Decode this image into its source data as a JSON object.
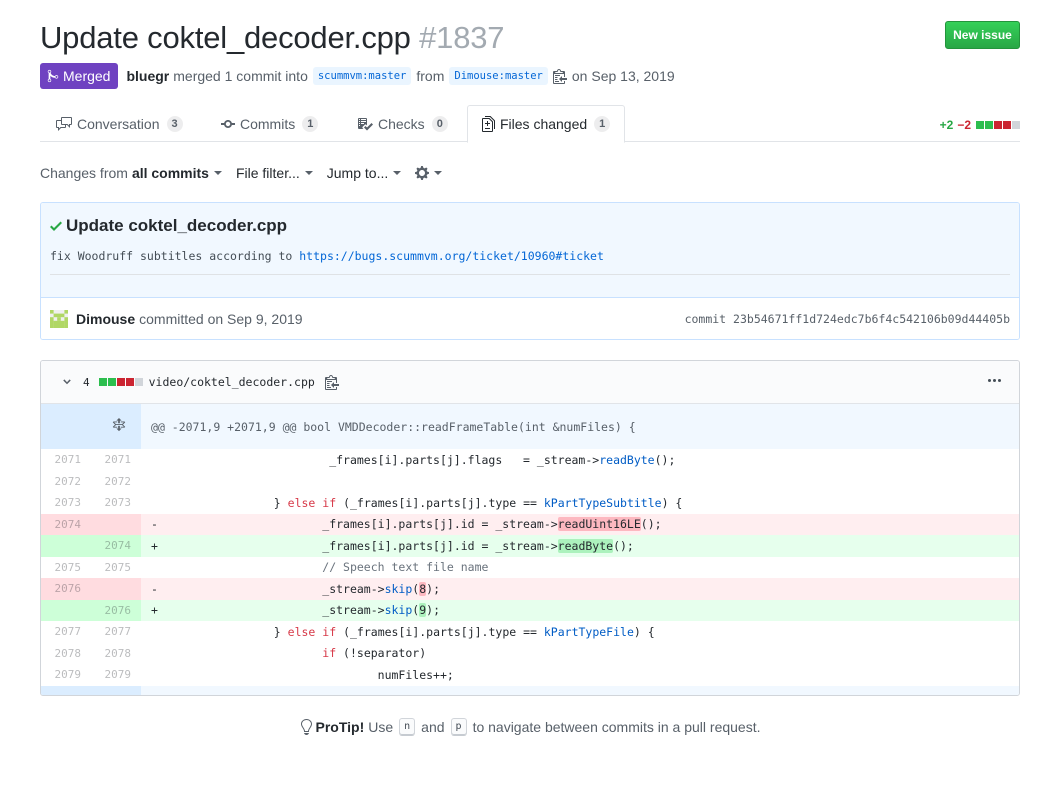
{
  "header": {
    "title": "Update coktel_decoder.cpp",
    "number": "#1837",
    "new_issue_label": "New issue"
  },
  "meta": {
    "state_label": "Merged",
    "author": "bluegr",
    "action_text": "merged 1 commit into",
    "base_branch": "scummvm:master",
    "from_text": "from",
    "head_branch": "Dimouse:master",
    "date_text": "on Sep 13, 2019"
  },
  "tabs": [
    {
      "label": "Conversation",
      "count": "3",
      "icon": "comment-discussion-icon"
    },
    {
      "label": "Commits",
      "count": "1",
      "icon": "git-commit-icon"
    },
    {
      "label": "Checks",
      "count": "0",
      "icon": "checklist-icon"
    },
    {
      "label": "Files changed",
      "count": "1",
      "icon": "file-diff-icon",
      "selected": true
    }
  ],
  "diffstat": {
    "additions": "+2",
    "deletions": "−2"
  },
  "toolbar": {
    "changes_prefix": "Changes from",
    "changes_value": "all commits",
    "file_filter": "File filter...",
    "jump_to": "Jump to..."
  },
  "commit": {
    "title": "Update coktel_decoder.cpp",
    "desc_text": "fix Woodruff subtitles according to ",
    "desc_link": "https://bugs.scummvm.org/ticket/10960#ticket",
    "author": "Dimouse",
    "committed_text": "committed on Sep 9, 2019",
    "sha_label": "commit",
    "sha": "23b54671ff1d724edc7b6f4c542106b09d44405b"
  },
  "file": {
    "change_count": "4",
    "path": "video/coktel_decoder.cpp",
    "hunk_header": "@@ -2071,9 +2071,9 @@ bool VMDDecoder::readFrameTable(int &numFiles) {"
  },
  "diff_lines": [
    {
      "type": "ctx",
      "old": "2071",
      "new": "2071"
    },
    {
      "type": "ctx",
      "old": "2072",
      "new": "2072"
    },
    {
      "type": "ctx",
      "old": "2073",
      "new": "2073"
    },
    {
      "type": "del",
      "old": "2074",
      "new": ""
    },
    {
      "type": "add",
      "old": "",
      "new": "2074"
    },
    {
      "type": "ctx",
      "old": "2075",
      "new": "2075"
    },
    {
      "type": "del",
      "old": "2076",
      "new": ""
    },
    {
      "type": "add",
      "old": "",
      "new": "2076"
    },
    {
      "type": "ctx",
      "old": "2077",
      "new": "2077"
    },
    {
      "type": "ctx",
      "old": "2078",
      "new": "2078"
    },
    {
      "type": "ctx",
      "old": "2079",
      "new": "2079"
    }
  ],
  "code": {
    "l1_a": "_frames[i].parts[j].flags   = _stream->",
    "l1_fn": "readByte",
    "l1_b": "();",
    "l3_a": "} ",
    "l3_kw1": "else",
    "l3_sp": " ",
    "l3_kw2": "if",
    "l3_b": " (_frames[i].parts[j].type == ",
    "l3_fn": "kPartTypeSubtitle",
    "l3_c": ") {",
    "l4_mark": "-",
    "l4_a": "_frames[i].parts[j].id = _stream->",
    "l4_hl": "readUint16LE",
    "l4_b": "();",
    "l5_mark": "+",
    "l5_a": "_frames[i].parts[j].id = _stream->",
    "l5_hl": "readByte",
    "l5_b": "();",
    "l6_cm": "// Speech text file name",
    "l7_mark": "-",
    "l7_a": "_stream->",
    "l7_fn": "skip",
    "l7_p1": "(",
    "l7_hl": "8",
    "l7_p2": ");",
    "l8_mark": "+",
    "l8_a": "_stream->",
    "l8_fn": "skip",
    "l8_p1": "(",
    "l8_hl": "9",
    "l8_p2": ");",
    "l9_a": "} ",
    "l9_kw1": "else",
    "l9_sp": " ",
    "l9_kw2": "if",
    "l9_b": " (_frames[i].parts[j].type == ",
    "l9_fn": "kPartTypeFile",
    "l9_c": ") {",
    "l10_kw": "if",
    "l10_b": " (!separator)",
    "l11_a": "numFiles++;"
  },
  "protip": {
    "label": "ProTip!",
    "text1": "Use",
    "key1": "n",
    "text2": "and",
    "key2": "p",
    "text3": "to navigate between commits in a pull request."
  },
  "colors": {
    "merged": "#6f42c1",
    "new_issue": "#2cbe4e",
    "addition": "#28a745",
    "deletion": "#cb2431",
    "link": "#0366d6"
  }
}
